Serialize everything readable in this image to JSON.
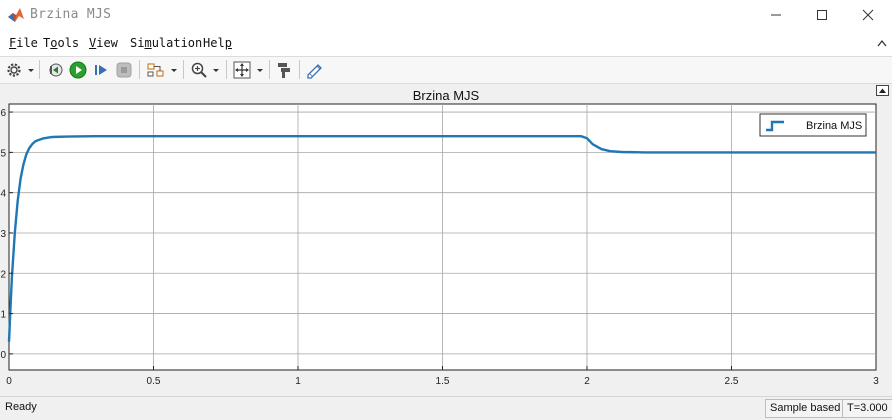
{
  "window": {
    "title": "Brzina MJS",
    "icon": "matlab-icon"
  },
  "menu": {
    "items": [
      {
        "mnemonic": "F",
        "rest": "ile"
      },
      {
        "mnemonic": "",
        "prefix": "T",
        "rest": "ools",
        "underline_index": 1
      },
      {
        "mnemonic": "V",
        "rest": "iew"
      },
      {
        "mnemonic": "",
        "rest": "Simulation"
      },
      {
        "mnemonic": "",
        "rest": "Help"
      }
    ]
  },
  "menu_labels": {
    "file": [
      "F",
      "ile"
    ],
    "tools": [
      "T",
      "o",
      "ols"
    ],
    "view": [
      "V",
      "iew"
    ],
    "simulation": [
      "Si",
      "m",
      "ulation"
    ],
    "help": [
      "Hel",
      "p"
    ]
  },
  "toolbar": {
    "icons": [
      "gear-icon",
      "step-back-icon",
      "run-icon",
      "step-forward-icon",
      "stop-icon",
      "highlight-icon",
      "zoom-icon",
      "fit-to-view-icon",
      "style-icon",
      "edit-icon"
    ]
  },
  "status": {
    "left": "Ready",
    "mode": "Sample based",
    "time": "T=3.000"
  },
  "colors": {
    "line": "#1f77b4",
    "accent_run": "#2aa12a",
    "grid": "#a6a6a6"
  },
  "chart_data": {
    "type": "line",
    "title": "Brzina MJS",
    "xlim": [
      0,
      3
    ],
    "ylim": [
      -0.4,
      6.2
    ],
    "xticks": [
      "0",
      "0.5",
      "1",
      "1.5",
      "2",
      "2.5",
      "3"
    ],
    "yticks": [
      "0",
      "1",
      "2",
      "3",
      "4",
      "5",
      "6"
    ],
    "grid": true,
    "legend_position": "top-right",
    "series": [
      {
        "name": "Brzina MJS",
        "x": [
          0,
          0.005,
          0.01,
          0.02,
          0.03,
          0.04,
          0.05,
          0.06,
          0.07,
          0.08,
          0.09,
          0.1,
          0.12,
          0.15,
          0.2,
          0.3,
          0.5,
          1.0,
          1.5,
          1.98,
          2.0,
          2.02,
          2.05,
          2.08,
          2.12,
          2.2,
          2.3,
          2.5,
          3.0
        ],
        "y": [
          0.3,
          1.1,
          1.9,
          3.0,
          3.8,
          4.35,
          4.7,
          4.95,
          5.1,
          5.2,
          5.27,
          5.3,
          5.35,
          5.38,
          5.39,
          5.4,
          5.4,
          5.4,
          5.4,
          5.4,
          5.35,
          5.2,
          5.08,
          5.03,
          5.01,
          5.0,
          5.0,
          5.0,
          5.0
        ]
      }
    ]
  }
}
